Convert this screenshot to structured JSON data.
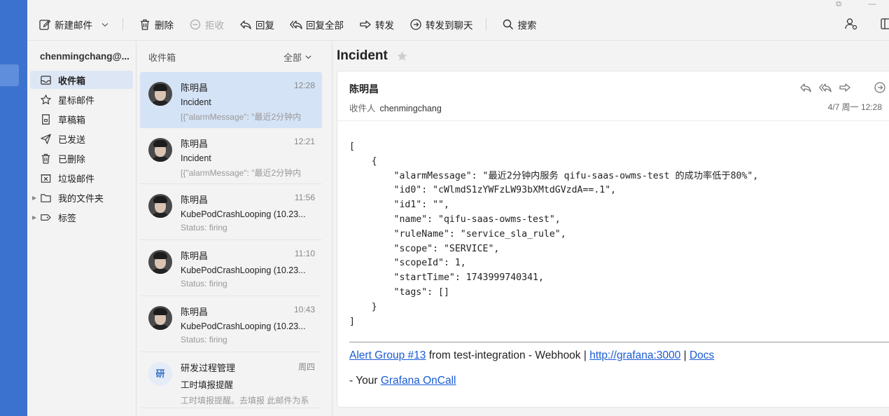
{
  "toolbar": {
    "new_mail": "新建邮件",
    "delete": "删除",
    "reject": "拒收",
    "reply": "回复",
    "reply_all": "回复全部",
    "forward": "转发",
    "forward_chat": "转发到聊天",
    "search": "搜索"
  },
  "sidebar": {
    "account": "chenmingchang@...",
    "items": [
      {
        "label": "收件箱",
        "icon": "inbox-icon"
      },
      {
        "label": "星标邮件",
        "icon": "star-icon"
      },
      {
        "label": "草稿箱",
        "icon": "draft-icon"
      },
      {
        "label": "已发送",
        "icon": "send-icon"
      },
      {
        "label": "已删除",
        "icon": "trash-icon"
      },
      {
        "label": "垃圾邮件",
        "icon": "junk-icon"
      },
      {
        "label": "我的文件夹",
        "icon": "folder-icon"
      },
      {
        "label": "标签",
        "icon": "tag-icon"
      }
    ]
  },
  "list": {
    "folder_title": "收件箱",
    "filter": "全部",
    "messages": [
      {
        "sender": "陈明昌",
        "time": "12:28",
        "subject": "Incident",
        "preview": "[{\"alarmMessage\": \"最近2分钟内"
      },
      {
        "sender": "陈明昌",
        "time": "12:21",
        "subject": "Incident",
        "preview": "[{\"alarmMessage\": \"最近2分钟内"
      },
      {
        "sender": "陈明昌",
        "time": "11:56",
        "subject": "KubePodCrashLooping (10.23...",
        "preview": "Status: firing"
      },
      {
        "sender": "陈明昌",
        "time": "11:10",
        "subject": "KubePodCrashLooping (10.23...",
        "preview": "Status: firing"
      },
      {
        "sender": "陈明昌",
        "time": "10:43",
        "subject": "KubePodCrashLooping (10.23...",
        "preview": "Status: firing"
      },
      {
        "sender": "研发过程管理",
        "time": "周四",
        "subject": "工时填报提醒",
        "preview": "工时填报提醒。去填报 此邮件为系",
        "avatar_text": "研"
      }
    ]
  },
  "reader": {
    "title": "Incident",
    "sender": "陈明昌",
    "recipient_label": "收件人",
    "recipient": "chenmingchang",
    "date": "4/7 周一 12:28",
    "body_json": "[\n    {\n        \"alarmMessage\": \"最近2分钟内服务 qifu-saas-owms-test 的成功率低于80%\",\n        \"id0\": \"cWlmdS1zYWFzLW93bXMtdGVzdA==.1\",\n        \"id1\": \"\",\n        \"name\": \"qifu-saas-owms-test\",\n        \"ruleName\": \"service_sla_rule\",\n        \"scope\": \"SERVICE\",\n        \"scopeId\": 1,\n        \"startTime\": 1743999740341,\n        \"tags\": []\n    }\n]",
    "footer": {
      "alert_group_link": "Alert Group #13",
      "from_text": " from test-integration - Webhook | ",
      "grafana_link": "http://grafana:3000",
      "sep": " | ",
      "docs_link": "Docs",
      "your_text": "- Your ",
      "oncall_link": "Grafana OnCall"
    }
  }
}
